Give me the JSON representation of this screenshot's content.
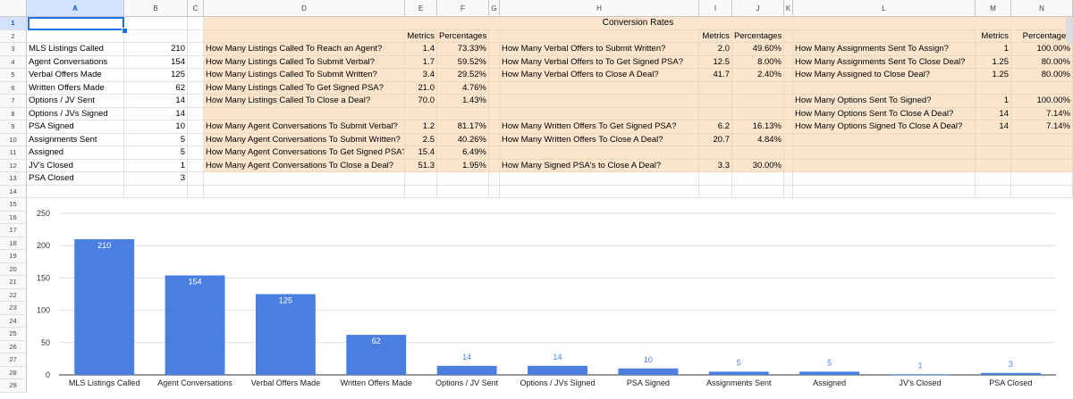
{
  "columns": [
    "A",
    "B",
    "C",
    "D",
    "E",
    "F",
    "G",
    "H",
    "I",
    "J",
    "K",
    "L",
    "M",
    "N"
  ],
  "rows": [
    "1",
    "2",
    "3",
    "4",
    "5",
    "6",
    "7",
    "8",
    "9",
    "10",
    "11",
    "12",
    "13",
    "14",
    "15",
    "16",
    "17",
    "18",
    "19",
    "20",
    "21",
    "22",
    "23",
    "24",
    "25",
    "26",
    "27",
    "28",
    "29"
  ],
  "summary": [
    {
      "label": "MLS Listings Called",
      "value": "210"
    },
    {
      "label": "Agent Conversations",
      "value": "154"
    },
    {
      "label": "Verbal Offers Made",
      "value": "125"
    },
    {
      "label": "Written Offers Made",
      "value": "62"
    },
    {
      "label": "Options / JV Sent",
      "value": "14"
    },
    {
      "label": "Options / JVs Signed",
      "value": "14"
    },
    {
      "label": "PSA Signed",
      "value": "10"
    },
    {
      "label": "Assignments Sent",
      "value": "5"
    },
    {
      "label": "Assigned",
      "value": "5"
    },
    {
      "label": "JV's Closed",
      "value": "1"
    },
    {
      "label": "PSA Closed",
      "value": "3"
    }
  ],
  "conversion_title": "Conversion Rates",
  "headers": {
    "metrics": "Metrics",
    "percentages": "Percentages"
  },
  "block1": [
    {
      "q": "How Many Listings Called To Reach an Agent?",
      "m": "1.4",
      "p": "73.33%"
    },
    {
      "q": "How Many Listings Called To Submit Verbal?",
      "m": "1.7",
      "p": "59.52%"
    },
    {
      "q": "How Many Listings Called To Submit Written?",
      "m": "3.4",
      "p": "29.52%"
    },
    {
      "q": "How Many Listings Called To Get Signed PSA?",
      "m": "21.0",
      "p": "4.76%"
    },
    {
      "q": "How Many Listings Called To Close a Deal?",
      "m": "70.0",
      "p": "1.43%"
    },
    {
      "q": "",
      "m": "",
      "p": ""
    },
    {
      "q": "How Many Agent Conversations To Submit Verbal?",
      "m": "1.2",
      "p": "81.17%"
    },
    {
      "q": "How Many Agent Conversations To Submit Written?",
      "m": "2.5",
      "p": "40.26%"
    },
    {
      "q": "How Many Agent Conversations To Get Signed PSA?",
      "m": "15.4",
      "p": "6.49%"
    },
    {
      "q": "How Many Agent Conversations To Close a Deal?",
      "m": "51.3",
      "p": "1.95%"
    }
  ],
  "block2": [
    {
      "q": "How Many Verbal Offers to Submit Written?",
      "m": "2.0",
      "p": "49.60%"
    },
    {
      "q": "How Many Verbal Offers to To Get Signed PSA?",
      "m": "12.5",
      "p": "8.00%"
    },
    {
      "q": "How Many Verbal Offers to Close A Deal?",
      "m": "41.7",
      "p": "2.40%"
    },
    {
      "q": "",
      "m": "",
      "p": ""
    },
    {
      "q": "",
      "m": "",
      "p": ""
    },
    {
      "q": "",
      "m": "",
      "p": ""
    },
    {
      "q": "How Many Written Offers To Get Signed PSA?",
      "m": "6.2",
      "p": "16.13%"
    },
    {
      "q": "How Many Written Offers To Close A Deal?",
      "m": "20.7",
      "p": "4.84%"
    },
    {
      "q": "",
      "m": "",
      "p": ""
    },
    {
      "q": "How Many Signed PSA's to Close A Deal?",
      "m": "3.3",
      "p": "30.00%"
    }
  ],
  "block3": [
    {
      "q": "How Many Assignments Sent To Assign?",
      "m": "1",
      "p": "100.00%"
    },
    {
      "q": "How Many Assignments Sent To Close Deal?",
      "m": "1.25",
      "p": "80.00%"
    },
    {
      "q": "How Many Assigned to Close Deal?",
      "m": "1.25",
      "p": "80.00%"
    },
    {
      "q": "",
      "m": "",
      "p": ""
    },
    {
      "q": "How Many Options Sent To Signed?",
      "m": "1",
      "p": "100.00%"
    },
    {
      "q": "How Many Options Sent To Close A Deal?",
      "m": "14",
      "p": "7.14%"
    },
    {
      "q": "How Many Options Signed To Close A Deal?",
      "m": "14",
      "p": "7.14%"
    },
    {
      "q": "",
      "m": "",
      "p": ""
    },
    {
      "q": "",
      "m": "",
      "p": ""
    },
    {
      "q": "",
      "m": "",
      "p": ""
    }
  ],
  "colors": {
    "bar": "#4a7fe0",
    "tan": "#fce5cd",
    "selection": "#1a73e8"
  },
  "chart_data": {
    "type": "bar",
    "categories": [
      "MLS Listings Called",
      "Agent Conversations",
      "Verbal Offers Made",
      "Written Offers Made",
      "Options / JV Sent",
      "Options / JVs Signed",
      "PSA Signed",
      "Assignments Sent",
      "Assigned",
      "JV's Closed",
      "PSA Closed"
    ],
    "values": [
      210,
      154,
      125,
      62,
      14,
      14,
      10,
      5,
      5,
      1,
      3
    ],
    "ylim": [
      0,
      250
    ],
    "yticks": [
      "0",
      "50",
      "100",
      "150",
      "200",
      "250"
    ],
    "grid": true,
    "data_labels": [
      "210",
      "154",
      "125",
      "62",
      "14",
      "14",
      "10",
      "5",
      "5",
      "1",
      "3"
    ]
  }
}
